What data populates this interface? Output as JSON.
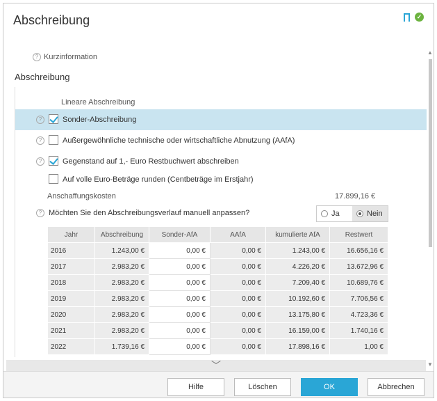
{
  "window": {
    "title": "Abschreibung"
  },
  "icons": {
    "bookmark": "bookmark-icon",
    "status": "check-circle-icon",
    "help": "help-icon"
  },
  "kurzinfo": {
    "label": "Kurzinformation"
  },
  "section": {
    "title": "Abschreibung"
  },
  "options": {
    "linear_label": "Lineare Abschreibung",
    "sonder": {
      "label": "Sonder-Abschreibung",
      "checked": true
    },
    "aafa": {
      "label": "Außergewöhnliche technische oder wirtschaftliche Abnutzung (AAfA)",
      "checked": false
    },
    "restwert": {
      "label": "Gegenstand auf 1,- Euro Restbuchwert abschreiben",
      "checked": true
    },
    "runden": {
      "label": "Auf volle Euro-Beträge runden (Centbeträge im Erstjahr)",
      "checked": false
    }
  },
  "anschaffung": {
    "label": "Anschaffungskosten",
    "value": "17.899,16 €"
  },
  "manuell": {
    "question": "Möchten Sie den Abschreibungsverlauf manuell anpassen?",
    "options": [
      "Ja",
      "Nein"
    ],
    "selected": "Nein"
  },
  "table": {
    "headers": [
      "Jahr",
      "Abschreibung",
      "Sonder-AfA",
      "AAfA",
      "kumulierte AfA",
      "Restwert"
    ],
    "rows": [
      [
        "2016",
        "1.243,00 €",
        "0,00 €",
        "0,00 €",
        "1.243,00 €",
        "16.656,16 €"
      ],
      [
        "2017",
        "2.983,20 €",
        "0,00 €",
        "0,00 €",
        "4.226,20 €",
        "13.672,96 €"
      ],
      [
        "2018",
        "2.983,20 €",
        "0,00 €",
        "0,00 €",
        "7.209,40 €",
        "10.689,76 €"
      ],
      [
        "2019",
        "2.983,20 €",
        "0,00 €",
        "0,00 €",
        "10.192,60 €",
        "7.706,56 €"
      ],
      [
        "2020",
        "2.983,20 €",
        "0,00 €",
        "0,00 €",
        "13.175,80 €",
        "4.723,36 €"
      ],
      [
        "2021",
        "2.983,20 €",
        "0,00 €",
        "0,00 €",
        "16.159,00 €",
        "1.740,16 €"
      ],
      [
        "2022",
        "1.739,16 €",
        "0,00 €",
        "0,00 €",
        "17.898,16 €",
        "1,00 €"
      ]
    ]
  },
  "buttons": {
    "help": "Hilfe",
    "delete": "Löschen",
    "ok": "OK",
    "cancel": "Abbrechen"
  },
  "colors": {
    "accent": "#2aa6d6",
    "highlight": "#c9e4f0",
    "success": "#6cb33f"
  }
}
